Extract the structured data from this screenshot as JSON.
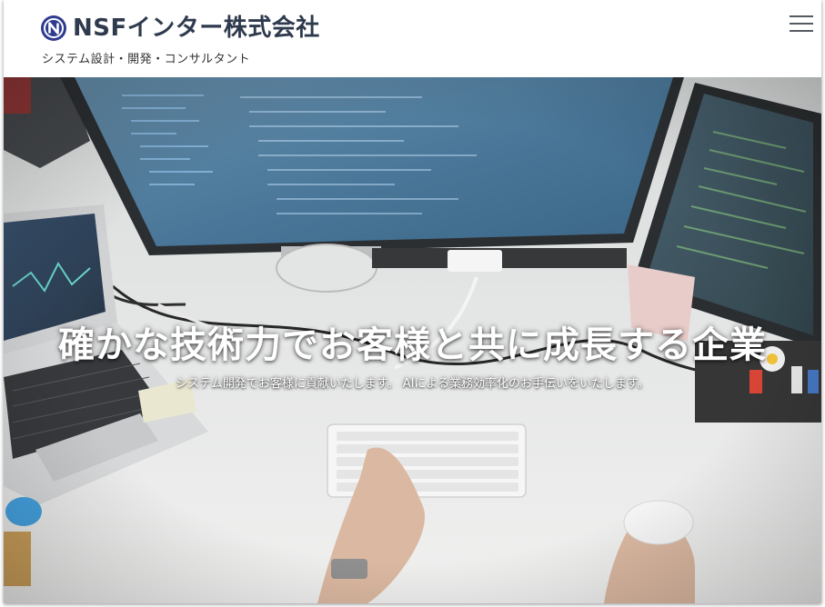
{
  "header": {
    "brand_name": "NSFインター株式会社",
    "tagline": "システム設計・開発・コンサルタント",
    "logo_icon": "nsf-logo-icon",
    "menu_icon": "hamburger-menu-icon"
  },
  "hero": {
    "title": "確かな技術力でお客様と共に成長する企業",
    "subtitle": "システム開発でお客様に貢献いたします。 AIによる業務効率化のお手伝いをいたします。",
    "image_subject": "desk-workspace-photo"
  },
  "colors": {
    "brand": "#2e3a4d",
    "logo": "#2f3b8f",
    "hero_text": "#ffffff"
  }
}
